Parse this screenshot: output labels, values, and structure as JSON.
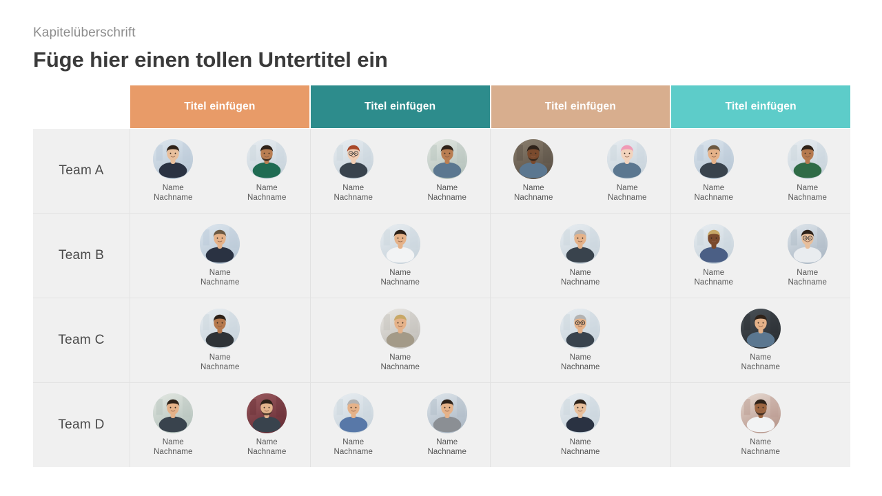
{
  "page": {
    "kicker": "Kapitelüberschrift",
    "title": "Füge hier einen tollen Untertitel ein"
  },
  "colors": {
    "header_1": "#e89b68",
    "header_2": "#2d8c8c",
    "header_3": "#d8ae8e",
    "header_4": "#5dccc9",
    "cell_background": "#f0f0f0",
    "divider": "#e2e2e2",
    "title_text": "#3a3a3a",
    "kicker_text": "#8d8d8d",
    "header_text": "#ffffff",
    "team_label_text": "#4a4a4a",
    "person_name_text": "#555555"
  },
  "table": {
    "columns": [
      {
        "label": "Titel einfügen",
        "color": "#e89b68"
      },
      {
        "label": "Titel einfügen",
        "color": "#2d8c8c"
      },
      {
        "label": "Titel einfügen",
        "color": "#d8ae8e"
      },
      {
        "label": "Titel einfügen",
        "color": "#5dccc9"
      }
    ],
    "rows": [
      {
        "label": "Team A",
        "cells": [
          [
            {
              "name": "Name\nNachname",
              "photo": "businesswoman-dark-suit-city"
            },
            {
              "name": "Name\nNachname",
              "photo": "man-green-sweater-arms-crossed"
            }
          ],
          [
            {
              "name": "Name\nNachname",
              "photo": "redhead-woman-glasses"
            },
            {
              "name": "Name\nNachname",
              "photo": "man-plaid-shirt-outdoors"
            }
          ],
          [
            {
              "name": "Name\nNachname",
              "photo": "man-library-denim-shirt"
            },
            {
              "name": "Name\nNachname",
              "photo": "woman-pink-hair-denim"
            }
          ],
          [
            {
              "name": "Name\nNachname",
              "photo": "man-coat-street"
            },
            {
              "name": "Name\nNachname",
              "photo": "man-green-shirt-smiling"
            }
          ]
        ]
      },
      {
        "label": "Team B",
        "cells": [
          [
            {
              "name": "Name\nNachname",
              "photo": "man-navy-blazer-waterfront"
            }
          ],
          [
            {
              "name": "Name\nNachname",
              "photo": "woman-white-blouse-arms-crossed"
            }
          ],
          [
            {
              "name": "Name\nNachname",
              "photo": "senior-man-suit-thumbs-up"
            }
          ],
          [
            {
              "name": "Name\nNachname",
              "photo": "woman-curly-updo-dotted-top"
            },
            {
              "name": "Name\nNachname",
              "photo": "woman-glasses-thumbs-up-cafe"
            }
          ]
        ]
      },
      {
        "label": "Team C",
        "cells": [
          [
            {
              "name": "Name\nNachname",
              "photo": "young-man-hoodie-smiling"
            }
          ],
          [
            {
              "name": "Name\nNachname",
              "photo": "older-woman-short-blonde-hair"
            }
          ],
          [
            {
              "name": "Name\nNachname",
              "photo": "grey-haired-man-glasses-dark-jacket"
            }
          ],
          [
            {
              "name": "Name\nNachname",
              "photo": "young-man-dark-background-denim"
            }
          ]
        ]
      },
      {
        "label": "Team D",
        "cells": [
          [
            {
              "name": "Name\nNachname",
              "photo": "woman-curly-hair-beach"
            },
            {
              "name": "Name\nNachname",
              "photo": "man-beard-burgundy-background"
            }
          ],
          [
            {
              "name": "Name\nNachname",
              "photo": "woman-floral-blouse-grey-hair"
            },
            {
              "name": "Name\nNachname",
              "photo": "woman-grey-suit-hallway"
            }
          ],
          [
            {
              "name": "Name\nNachname",
              "photo": "woman-dark-blazer-bob-haircut"
            }
          ],
          [
            {
              "name": "Name\nNachname",
              "photo": "man-curly-hair-white-tshirt"
            }
          ]
        ]
      }
    ]
  }
}
